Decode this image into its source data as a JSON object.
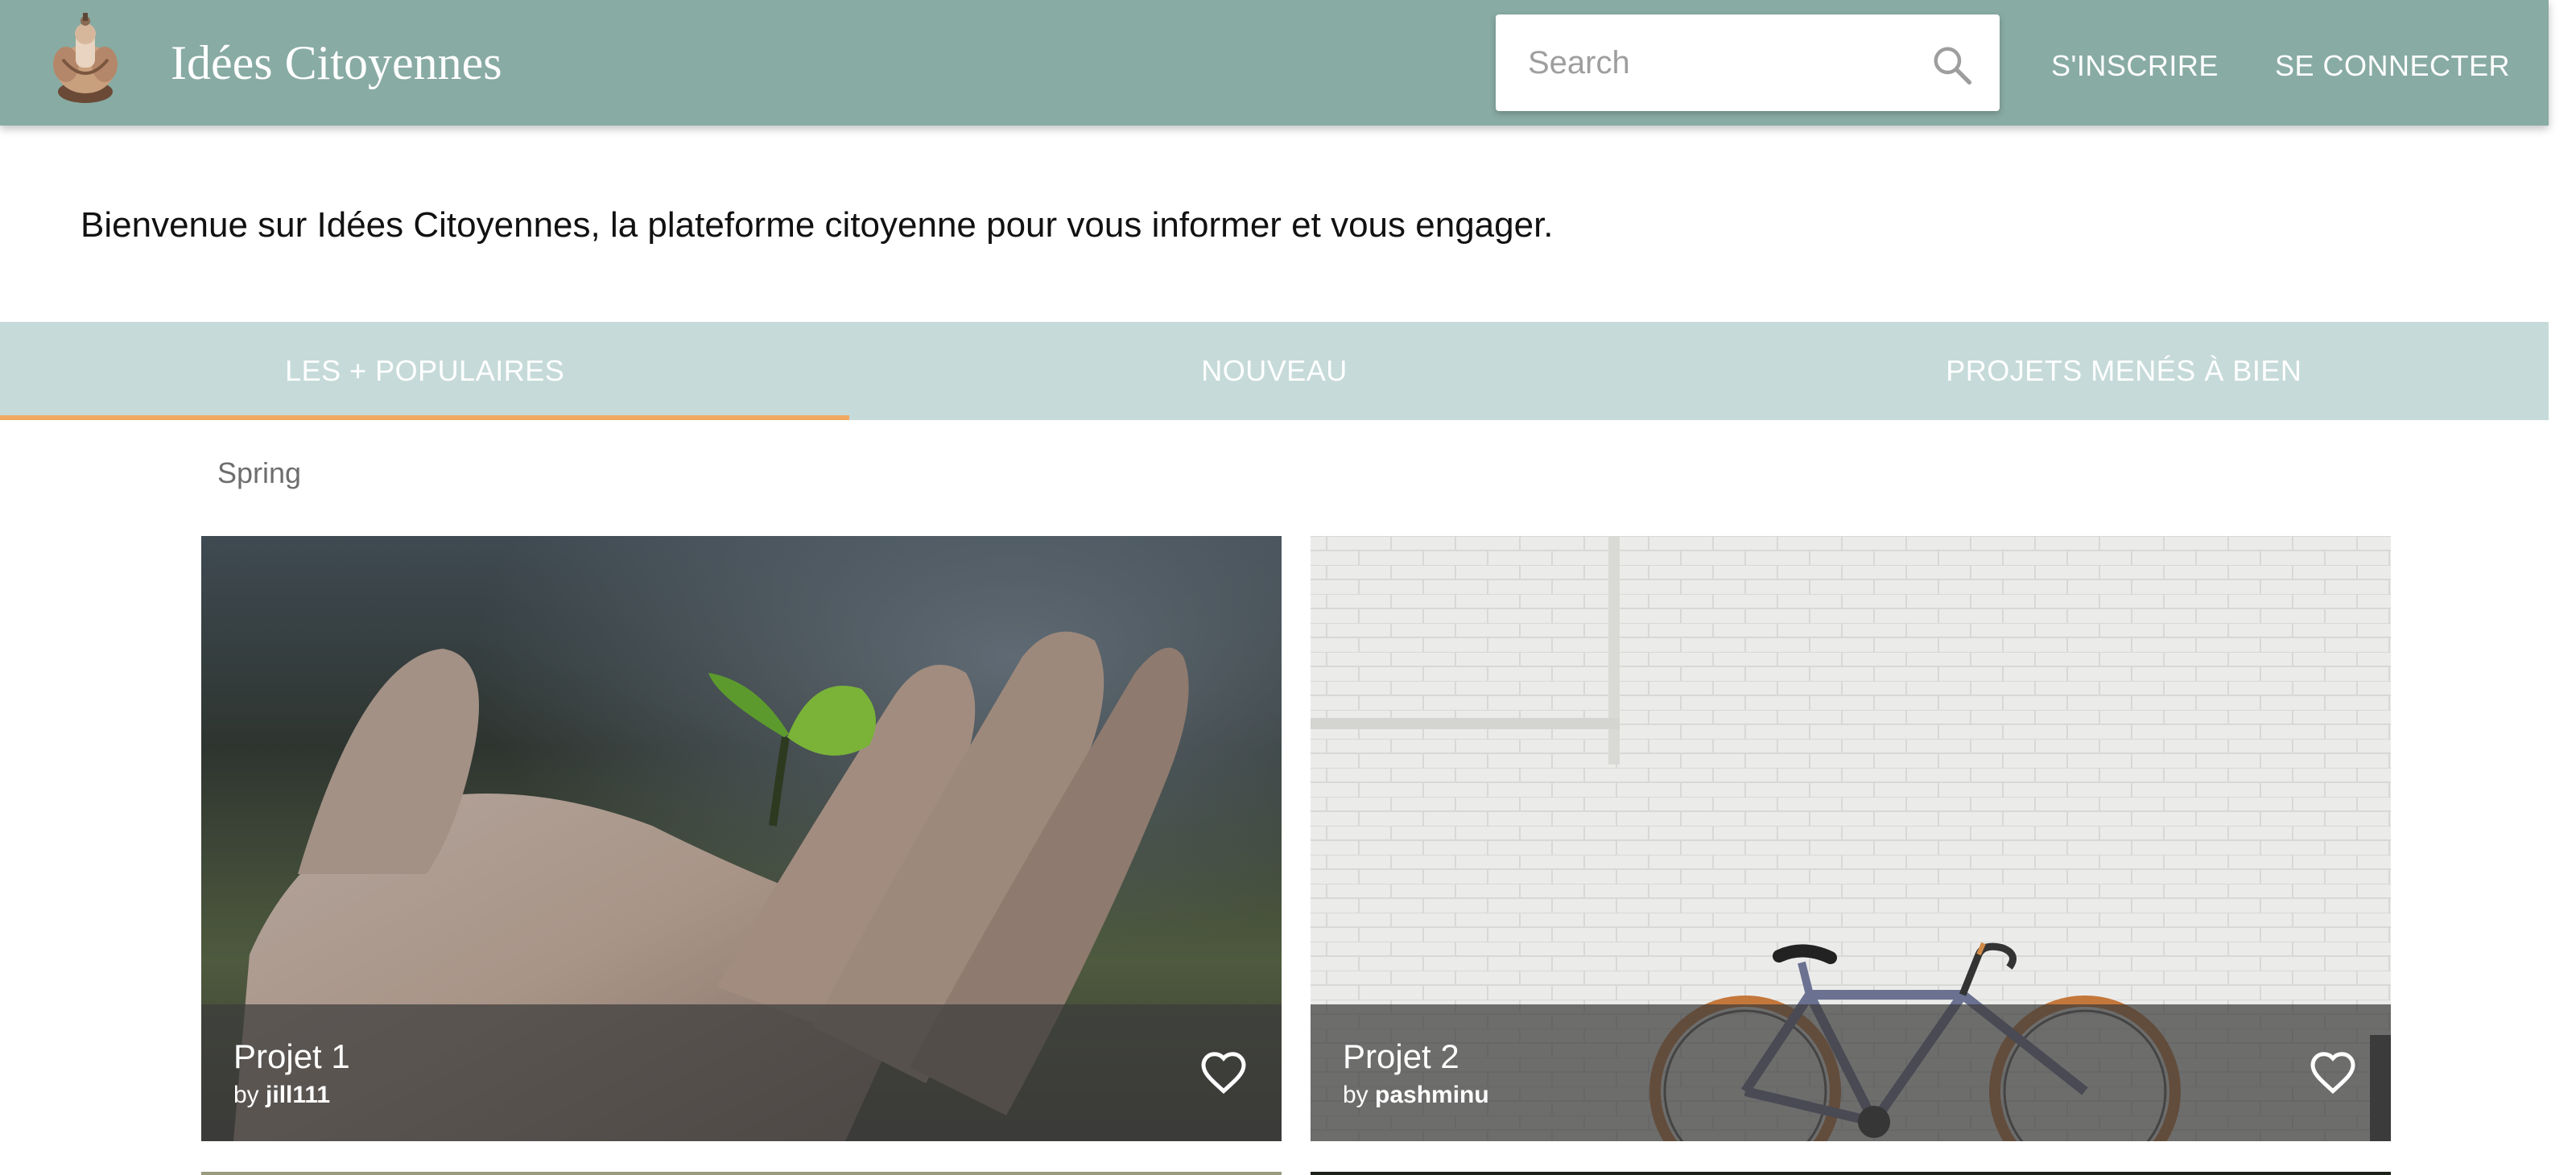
{
  "header": {
    "app_title": "Idées Citoyennes",
    "search_placeholder": "Search",
    "register_label": "S'INSCRIRE",
    "login_label": "SE CONNECTER",
    "background_color": "#88aba3"
  },
  "welcome_text": "Bienvenue sur Idées Citoyennes, la plateforme citoyenne pour vous informer et vous engager.",
  "tabs": [
    {
      "label": "LES + POPULAIRES",
      "active": true
    },
    {
      "label": "NOUVEAU",
      "active": false
    },
    {
      "label": "PROJETS MENÉS À BIEN",
      "active": false
    }
  ],
  "tab_colors": {
    "background": "#c6dbd9",
    "indicator": "#f0a962"
  },
  "category": "Spring",
  "cards": [
    {
      "title": "Projet 1",
      "by": "by",
      "author": "jill111",
      "image": "hand-with-sprout",
      "icon": "heart-outline-icon"
    },
    {
      "title": "Projet 2",
      "by": "by",
      "author": "pashminu",
      "image": "bicycle-against-white-brick-wall",
      "icon": "heart-outline-icon"
    }
  ]
}
